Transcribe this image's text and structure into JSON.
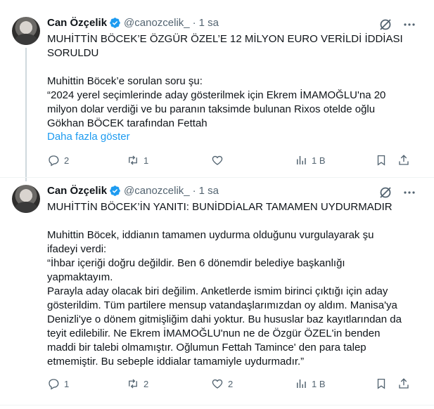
{
  "colors": {
    "accent": "#1d9bf0",
    "muted": "#536471",
    "text": "#0f1419",
    "verified": "#1d9bf0"
  },
  "tweets": [
    {
      "name": "Can Özçelik",
      "handle": "@canozcelik_",
      "dot": "·",
      "time": "1 sa",
      "body": "MUHİTTİN BÖCEK’E ÖZGÜR ÖZEL’E 12 MİLYON EURO VERİLDİ İDDİASI\nSORULDU\n\nMuhittin Böcek’e sorulan soru şu:\n“2024 yerel seçimlerinde aday gösterilmek için Ekrem İMAMOĞLU'na 20\nmilyon dolar verdiği ve bu paranın taksimde bulunan Rixos otelde oğlu\nGökhan BÖCEK tarafından Fettah",
      "show_more": "Daha fazla göster",
      "replies": "2",
      "reposts": "1",
      "likes": "",
      "views": "1 B"
    },
    {
      "name": "Can Özçelik",
      "handle": "@canozcelik_",
      "dot": "·",
      "time": "1 sa",
      "body": "MUHİTTİN BÖCEK’İN YANITI: BUNİDDİALAR TAMAMEN UYDURMADIR\n\nMuhittin Böcek, iddianın tamamen uydurma olduğunu vurgulayarak şu\nifadeyi verdi:\n“İhbar içeriği doğru değildir. Ben 6 dönemdir belediye başkanlığı\nyapmaktayım.\nParayla aday olacak biri değilim. Anketlerde ismim birinci çıktığı için aday\ngösterildim. Tüm partilere mensup vatandaşlarımızdan oy aldım. Manisa'ya\nDenizli'ye o dönem gitmişliğim dahi yoktur. Bu hususlar baz kayıtlarından da\nteyit edilebilir. Ne Ekrem İMAMOĞLU'nun ne de Özgür ÖZEL'in benden\nmaddi bir talebi olmamıştır. Oğlumun Fettah Tamince' den para talep\netmemiştir. Bu sebeple iddialar tamamiyle uydurmadır.”",
      "replies": "1",
      "reposts": "2",
      "likes": "2",
      "views": "1 B"
    }
  ]
}
